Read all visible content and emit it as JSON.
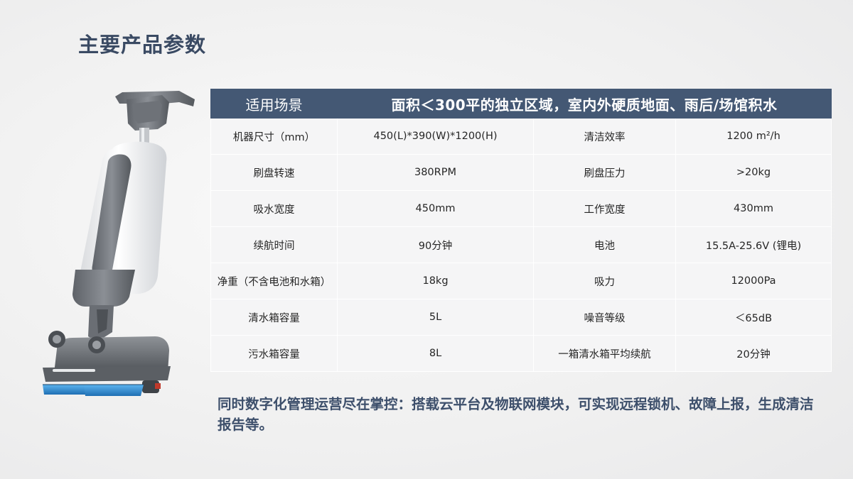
{
  "title": "主要产品参数",
  "table": {
    "header": {
      "label": "适用场景",
      "value": "面积＜300平的独立区域，室内外硬质地面、雨后/场馆积水"
    },
    "rows": [
      [
        "机器尺寸（mm）",
        "450(L)*390(W)*1200(H)",
        "清洁效率",
        "1200 m²/h"
      ],
      [
        "刷盘转速",
        "380RPM",
        "刷盘压力",
        ">20kg"
      ],
      [
        "吸水宽度",
        "450mm",
        "工作宽度",
        "430mm"
      ],
      [
        "续航时间",
        "90分钟",
        "电池",
        "15.5A-25.6V (锂电)"
      ],
      [
        "净重（不含电池和水箱）",
        "18kg",
        "吸力",
        "12000Pa"
      ],
      [
        "清水箱容量",
        "5L",
        "噪音等级",
        "＜65dB"
      ],
      [
        "污水箱容量",
        "8L",
        "一箱清水箱平均续航",
        "20分钟"
      ]
    ]
  },
  "note": "同时数字化管理运营尽在掌控：搭载云平台及物联网模块，可实现远程锁机、故障上报，生成清洁报告等。",
  "colors": {
    "header_bg": "#445874",
    "title": "#3a4a63",
    "note": "#3d4f6b",
    "cell_bg": "#f5f5f6",
    "brush": "#2e8fd6"
  }
}
